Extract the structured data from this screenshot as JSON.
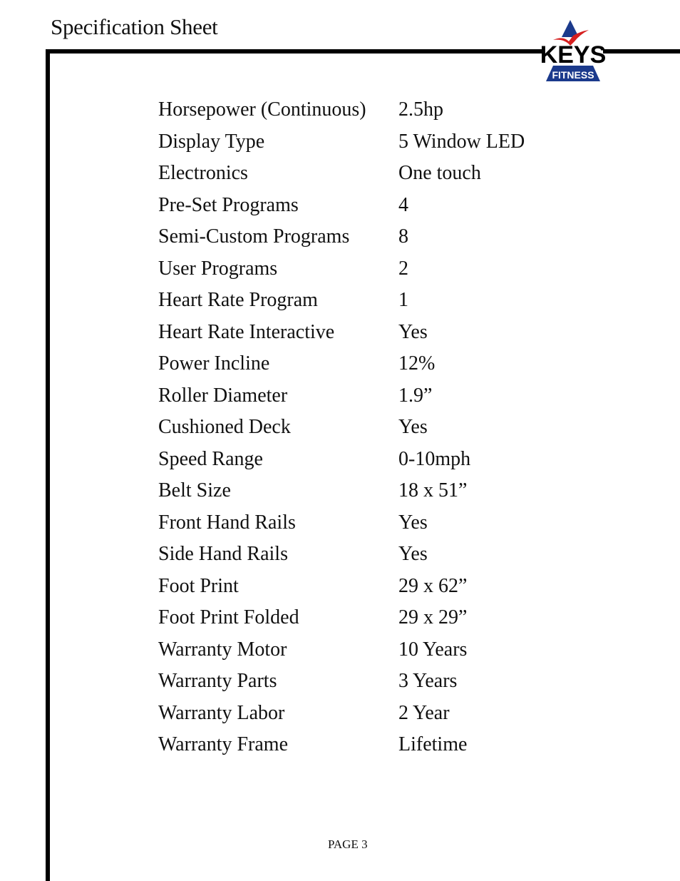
{
  "header": {
    "title": "Specification Sheet",
    "logo": {
      "brand": "KEYS",
      "subtitle": "FITNESS",
      "icon": "keys-fitness-logo-icon",
      "colors": {
        "triangle": "#1b3a8c",
        "swoosh": "#d62020",
        "text": "#000000",
        "subtitle_text": "#ffffff"
      }
    }
  },
  "specs": [
    {
      "label": "Horsepower (Continuous)",
      "value": "2.5hp"
    },
    {
      "label": "Display Type",
      "value": "5 Window LED"
    },
    {
      "label": "Electronics",
      "value": "One touch"
    },
    {
      "label": "Pre-Set Programs",
      "value": "4"
    },
    {
      "label": "Semi-Custom Programs",
      "value": "8"
    },
    {
      "label": "User Programs",
      "value": "2"
    },
    {
      "label": "Heart Rate Program",
      "value": "1"
    },
    {
      "label": "Heart Rate Interactive",
      "value": "Yes"
    },
    {
      "label": "Power Incline",
      "value": "12%"
    },
    {
      "label": "Roller Diameter",
      "value": "1.9”"
    },
    {
      "label": "Cushioned Deck",
      "value": "Yes"
    },
    {
      "label": "Speed Range",
      "value": "0-10mph"
    },
    {
      "label": "Belt Size",
      "value": "18 x 51”"
    },
    {
      "label": "Front Hand Rails",
      "value": "Yes"
    },
    {
      "label": "Side Hand Rails",
      "value": "Yes"
    },
    {
      "label": "Foot Print",
      "value": "29 x 62”"
    },
    {
      "label": "Foot Print Folded",
      "value": "29 x 29”"
    },
    {
      "label": "Warranty Motor",
      "value": "10 Years"
    },
    {
      "label": "Warranty Parts",
      "value": "3 Years"
    },
    {
      "label": "Warranty Labor",
      "value": "2 Year"
    },
    {
      "label": "Warranty Frame",
      "value": "Lifetime"
    }
  ],
  "footer": {
    "page_label": "PAGE 3"
  }
}
